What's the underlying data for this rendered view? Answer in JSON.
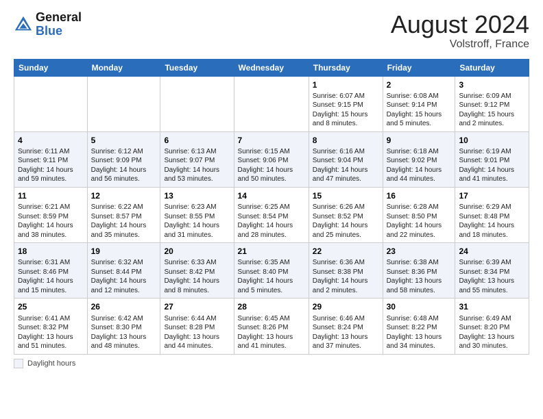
{
  "header": {
    "logo_line1": "General",
    "logo_line2": "Blue",
    "month_title": "August 2024",
    "location": "Volstroff, France"
  },
  "calendar": {
    "days_of_week": [
      "Sunday",
      "Monday",
      "Tuesday",
      "Wednesday",
      "Thursday",
      "Friday",
      "Saturday"
    ],
    "weeks": [
      [
        {
          "day": "",
          "info": ""
        },
        {
          "day": "",
          "info": ""
        },
        {
          "day": "",
          "info": ""
        },
        {
          "day": "",
          "info": ""
        },
        {
          "day": "1",
          "info": "Sunrise: 6:07 AM\nSunset: 9:15 PM\nDaylight: 15 hours\nand 8 minutes."
        },
        {
          "day": "2",
          "info": "Sunrise: 6:08 AM\nSunset: 9:14 PM\nDaylight: 15 hours\nand 5 minutes."
        },
        {
          "day": "3",
          "info": "Sunrise: 6:09 AM\nSunset: 9:12 PM\nDaylight: 15 hours\nand 2 minutes."
        }
      ],
      [
        {
          "day": "4",
          "info": "Sunrise: 6:11 AM\nSunset: 9:11 PM\nDaylight: 14 hours\nand 59 minutes."
        },
        {
          "day": "5",
          "info": "Sunrise: 6:12 AM\nSunset: 9:09 PM\nDaylight: 14 hours\nand 56 minutes."
        },
        {
          "day": "6",
          "info": "Sunrise: 6:13 AM\nSunset: 9:07 PM\nDaylight: 14 hours\nand 53 minutes."
        },
        {
          "day": "7",
          "info": "Sunrise: 6:15 AM\nSunset: 9:06 PM\nDaylight: 14 hours\nand 50 minutes."
        },
        {
          "day": "8",
          "info": "Sunrise: 6:16 AM\nSunset: 9:04 PM\nDaylight: 14 hours\nand 47 minutes."
        },
        {
          "day": "9",
          "info": "Sunrise: 6:18 AM\nSunset: 9:02 PM\nDaylight: 14 hours\nand 44 minutes."
        },
        {
          "day": "10",
          "info": "Sunrise: 6:19 AM\nSunset: 9:01 PM\nDaylight: 14 hours\nand 41 minutes."
        }
      ],
      [
        {
          "day": "11",
          "info": "Sunrise: 6:21 AM\nSunset: 8:59 PM\nDaylight: 14 hours\nand 38 minutes."
        },
        {
          "day": "12",
          "info": "Sunrise: 6:22 AM\nSunset: 8:57 PM\nDaylight: 14 hours\nand 35 minutes."
        },
        {
          "day": "13",
          "info": "Sunrise: 6:23 AM\nSunset: 8:55 PM\nDaylight: 14 hours\nand 31 minutes."
        },
        {
          "day": "14",
          "info": "Sunrise: 6:25 AM\nSunset: 8:54 PM\nDaylight: 14 hours\nand 28 minutes."
        },
        {
          "day": "15",
          "info": "Sunrise: 6:26 AM\nSunset: 8:52 PM\nDaylight: 14 hours\nand 25 minutes."
        },
        {
          "day": "16",
          "info": "Sunrise: 6:28 AM\nSunset: 8:50 PM\nDaylight: 14 hours\nand 22 minutes."
        },
        {
          "day": "17",
          "info": "Sunrise: 6:29 AM\nSunset: 8:48 PM\nDaylight: 14 hours\nand 18 minutes."
        }
      ],
      [
        {
          "day": "18",
          "info": "Sunrise: 6:31 AM\nSunset: 8:46 PM\nDaylight: 14 hours\nand 15 minutes."
        },
        {
          "day": "19",
          "info": "Sunrise: 6:32 AM\nSunset: 8:44 PM\nDaylight: 14 hours\nand 12 minutes."
        },
        {
          "day": "20",
          "info": "Sunrise: 6:33 AM\nSunset: 8:42 PM\nDaylight: 14 hours\nand 8 minutes."
        },
        {
          "day": "21",
          "info": "Sunrise: 6:35 AM\nSunset: 8:40 PM\nDaylight: 14 hours\nand 5 minutes."
        },
        {
          "day": "22",
          "info": "Sunrise: 6:36 AM\nSunset: 8:38 PM\nDaylight: 14 hours\nand 2 minutes."
        },
        {
          "day": "23",
          "info": "Sunrise: 6:38 AM\nSunset: 8:36 PM\nDaylight: 13 hours\nand 58 minutes."
        },
        {
          "day": "24",
          "info": "Sunrise: 6:39 AM\nSunset: 8:34 PM\nDaylight: 13 hours\nand 55 minutes."
        }
      ],
      [
        {
          "day": "25",
          "info": "Sunrise: 6:41 AM\nSunset: 8:32 PM\nDaylight: 13 hours\nand 51 minutes."
        },
        {
          "day": "26",
          "info": "Sunrise: 6:42 AM\nSunset: 8:30 PM\nDaylight: 13 hours\nand 48 minutes."
        },
        {
          "day": "27",
          "info": "Sunrise: 6:44 AM\nSunset: 8:28 PM\nDaylight: 13 hours\nand 44 minutes."
        },
        {
          "day": "28",
          "info": "Sunrise: 6:45 AM\nSunset: 8:26 PM\nDaylight: 13 hours\nand 41 minutes."
        },
        {
          "day": "29",
          "info": "Sunrise: 6:46 AM\nSunset: 8:24 PM\nDaylight: 13 hours\nand 37 minutes."
        },
        {
          "day": "30",
          "info": "Sunrise: 6:48 AM\nSunset: 8:22 PM\nDaylight: 13 hours\nand 34 minutes."
        },
        {
          "day": "31",
          "info": "Sunrise: 6:49 AM\nSunset: 8:20 PM\nDaylight: 13 hours\nand 30 minutes."
        }
      ]
    ]
  },
  "footer": {
    "daylight_label": "Daylight hours"
  }
}
